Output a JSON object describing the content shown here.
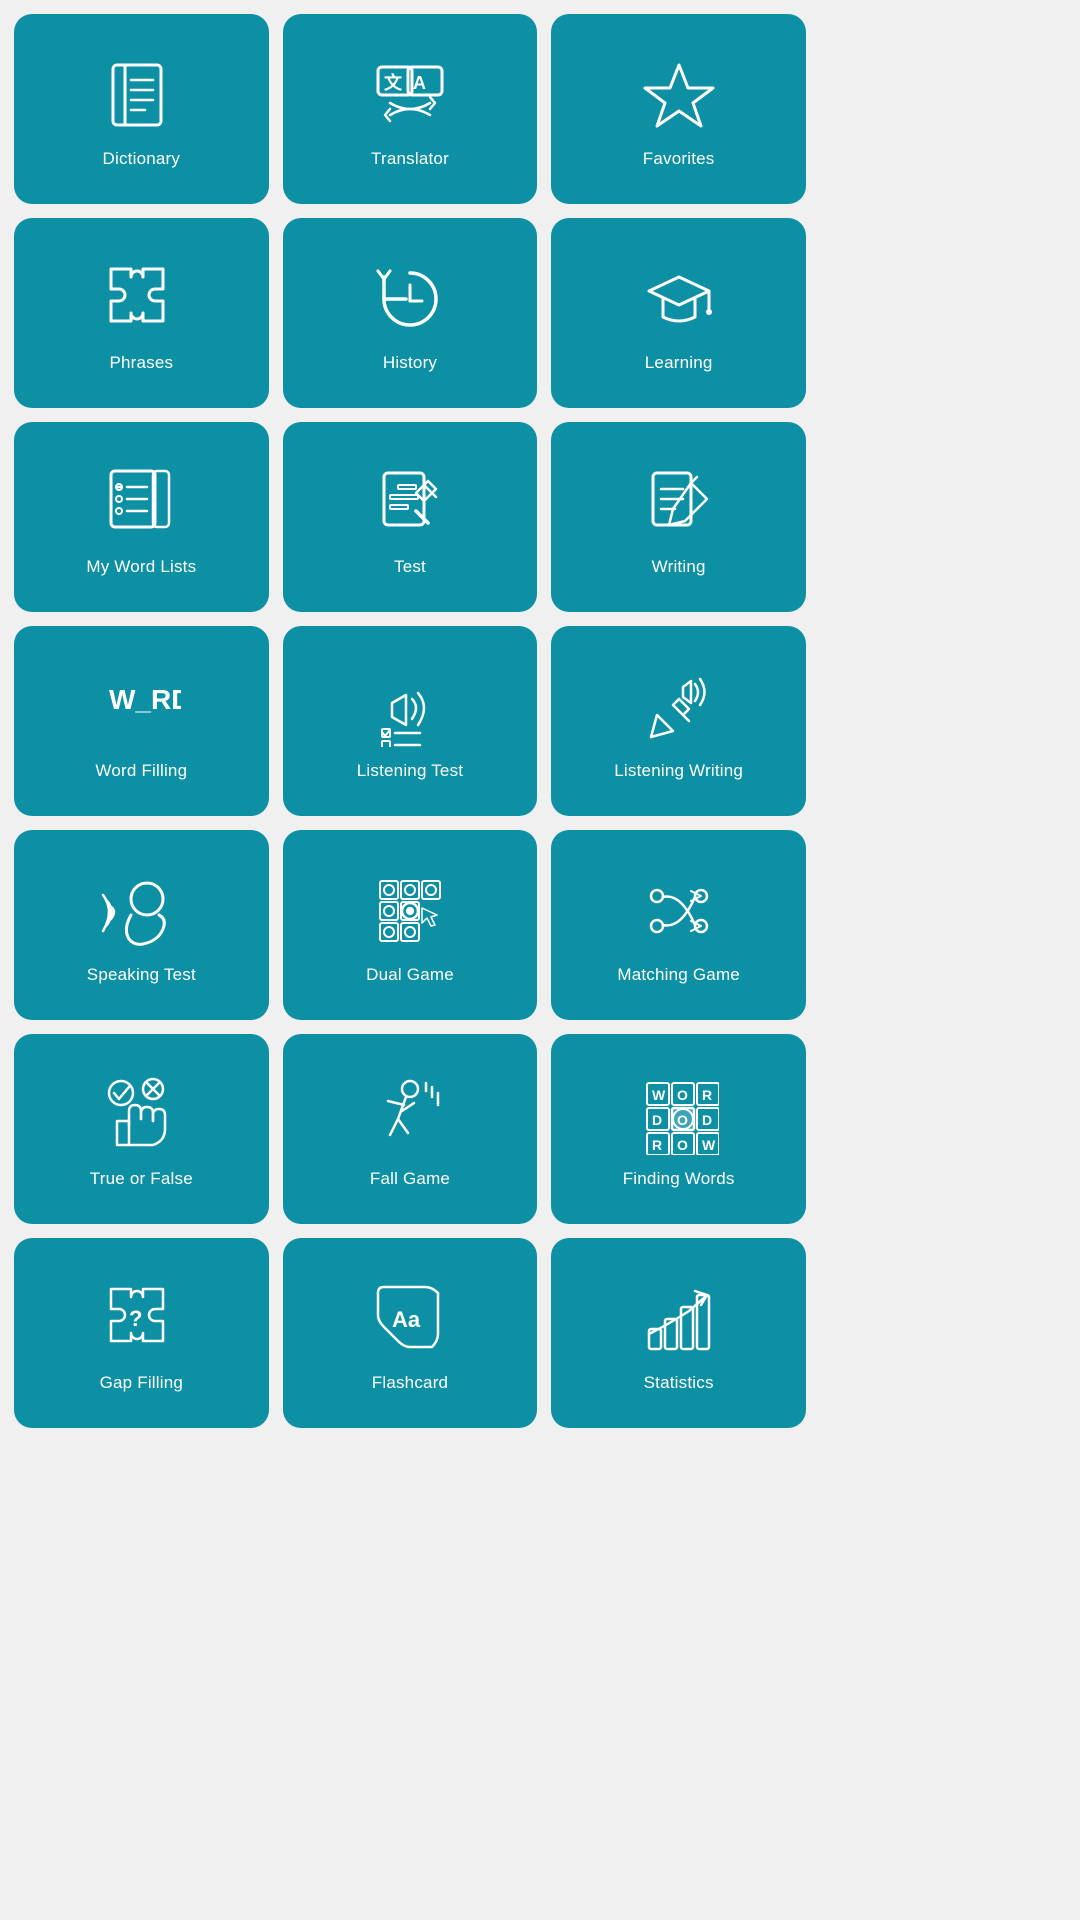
{
  "cards": [
    {
      "id": "dictionary",
      "label": "Dictionary"
    },
    {
      "id": "translator",
      "label": "Translator"
    },
    {
      "id": "favorites",
      "label": "Favorites"
    },
    {
      "id": "phrases",
      "label": "Phrases"
    },
    {
      "id": "history",
      "label": "History"
    },
    {
      "id": "learning",
      "label": "Learning"
    },
    {
      "id": "my-word-lists",
      "label": "My Word Lists"
    },
    {
      "id": "test",
      "label": "Test"
    },
    {
      "id": "writing",
      "label": "Writing"
    },
    {
      "id": "word-filling",
      "label": "Word Filling"
    },
    {
      "id": "listening-test",
      "label": "Listening Test"
    },
    {
      "id": "listening-writing",
      "label": "Listening Writing"
    },
    {
      "id": "speaking-test",
      "label": "Speaking Test"
    },
    {
      "id": "dual-game",
      "label": "Dual Game"
    },
    {
      "id": "matching-game",
      "label": "Matching Game"
    },
    {
      "id": "true-or-false",
      "label": "True or False"
    },
    {
      "id": "fall-game",
      "label": "Fall Game"
    },
    {
      "id": "finding-words",
      "label": "Finding Words"
    },
    {
      "id": "gap-filling",
      "label": "Gap Filling"
    },
    {
      "id": "flashcard",
      "label": "Flashcard"
    },
    {
      "id": "statistics",
      "label": "Statistics"
    }
  ]
}
